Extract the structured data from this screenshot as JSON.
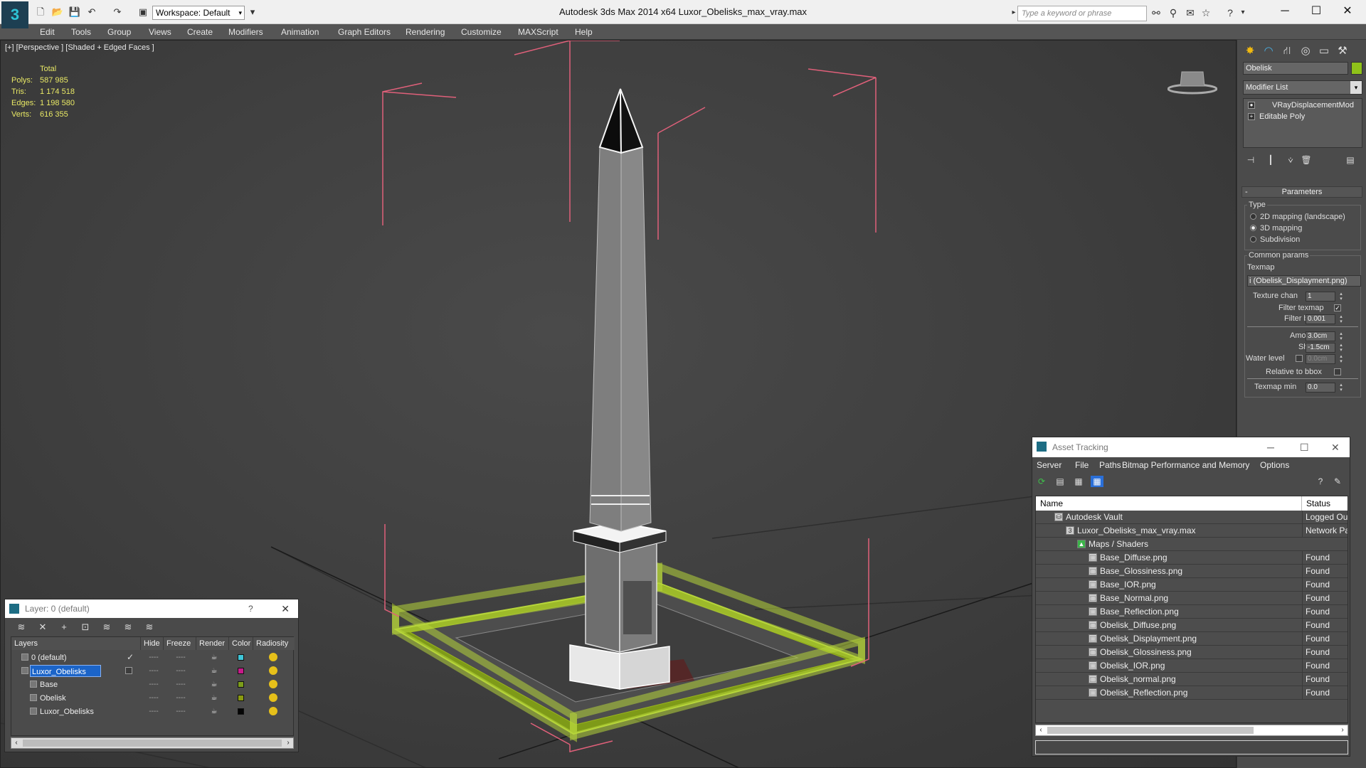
{
  "app": {
    "title": "Autodesk 3ds Max  2014 x64      Luxor_Obelisks_max_vray.max",
    "workspace": "Workspace: Default",
    "search_placeholder": "Type a keyword or phrase",
    "logo": "3"
  },
  "menu": [
    "Edit",
    "Tools",
    "Group",
    "Views",
    "Create",
    "Modifiers",
    "Animation",
    "Graph Editors",
    "Rendering",
    "Customize",
    "MAXScript",
    "Help"
  ],
  "viewport": {
    "label": "[+] [Perspective ] [Shaded + Edged Faces ]",
    "stats_header": "Total",
    "stats": [
      {
        "label": "Polys:",
        "value": "587 985"
      },
      {
        "label": "Tris:",
        "value": "1 174 518"
      },
      {
        "label": "Edges:",
        "value": "1 198 580"
      },
      {
        "label": "Verts:",
        "value": "616 355"
      }
    ],
    "colors": {
      "stats": "#e8e865",
      "bbox": "#e0607a",
      "fence": "#9ab51c"
    }
  },
  "command_panel": {
    "object_name": "Obelisk",
    "object_color": "#8fc21a",
    "modifier_list": "Modifier List",
    "stack": [
      "VRayDisplacementMod",
      "Editable Poly"
    ],
    "parameters_title": "Parameters",
    "type_label": "Type",
    "type_options": [
      {
        "label": "2D mapping (landscape)",
        "selected": false
      },
      {
        "label": "3D mapping",
        "selected": true
      },
      {
        "label": "Subdivision",
        "selected": false
      }
    ],
    "common_params": "Common params",
    "texmap_label": "Texmap",
    "texmap_value": "i (Obelisk_Displayment.png)",
    "texture_chan_label": "Texture chan",
    "texture_chan_value": "1",
    "filter_texmap_label": "Filter texmap",
    "filter_texmap_checked": true,
    "filter_blur_label": "Filter blur",
    "filter_blur_value": "0.001",
    "amount_label": "Amount",
    "amount_value": "3.0cm",
    "shift_label": "Shift",
    "shift_value": "-1.5cm",
    "water_level_label": "Water level",
    "water_level_value": "0.0cm",
    "relative_bbox_label": "Relative to bbox",
    "texmap_min_label": "Texmap min",
    "texmap_min_value": "0.0"
  },
  "layer_dialog": {
    "title": "Layer: 0 (default)",
    "help": "?",
    "columns": [
      "Layers",
      "Hide",
      "Freeze",
      "Render",
      "Color",
      "Radiosity"
    ],
    "rows": [
      {
        "name": "0 (default)",
        "indent": 0,
        "selected": false,
        "active": true,
        "color": "#3fc6d8"
      },
      {
        "name": "Luxor_Obelisks",
        "indent": 0,
        "selected": true,
        "active": false,
        "color": "#c81a8a"
      },
      {
        "name": "Base",
        "indent": 1,
        "selected": false,
        "active": false,
        "color": "#7c9d1a"
      },
      {
        "name": "Obelisk",
        "indent": 1,
        "selected": false,
        "active": false,
        "color": "#8a9a10"
      },
      {
        "name": "Luxor_Obelisks",
        "indent": 1,
        "selected": false,
        "active": false,
        "color": "#050505"
      }
    ],
    "dash": "----"
  },
  "asset_tracking": {
    "title": "Asset Tracking",
    "menu": [
      "Server",
      "File",
      "Paths",
      "Bitmap Performance and Memory",
      "Options"
    ],
    "columns": [
      "Name",
      "Status"
    ],
    "rows": [
      {
        "name": "Autodesk Vault",
        "indent": 1,
        "status": "Logged Out"
      },
      {
        "name": "Luxor_Obelisks_max_vray.max",
        "indent": 2,
        "status": "Network Pat"
      },
      {
        "name": "Maps / Shaders",
        "indent": 3,
        "status": ""
      },
      {
        "name": "Base_Diffuse.png",
        "indent": 4,
        "status": "Found"
      },
      {
        "name": "Base_Glossiness.png",
        "indent": 4,
        "status": "Found"
      },
      {
        "name": "Base_IOR.png",
        "indent": 4,
        "status": "Found"
      },
      {
        "name": "Base_Normal.png",
        "indent": 4,
        "status": "Found"
      },
      {
        "name": "Base_Reflection.png",
        "indent": 4,
        "status": "Found"
      },
      {
        "name": "Obelisk_Diffuse.png",
        "indent": 4,
        "status": "Found"
      },
      {
        "name": "Obelisk_Displayment.png",
        "indent": 4,
        "status": "Found"
      },
      {
        "name": "Obelisk_Glossiness.png",
        "indent": 4,
        "status": "Found"
      },
      {
        "name": "Obelisk_IOR.png",
        "indent": 4,
        "status": "Found"
      },
      {
        "name": "Obelisk_normal.png",
        "indent": 4,
        "status": "Found"
      },
      {
        "name": "Obelisk_Reflection.png",
        "indent": 4,
        "status": "Found"
      }
    ]
  }
}
